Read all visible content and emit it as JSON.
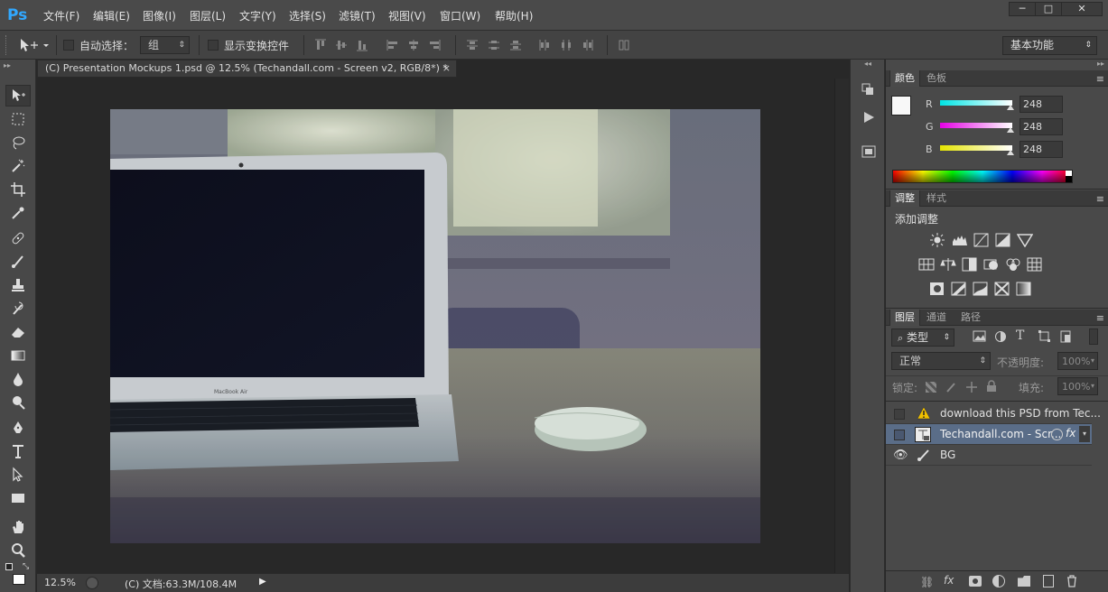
{
  "app": {
    "logo": "Ps"
  },
  "menu": [
    "文件(F)",
    "编辑(E)",
    "图像(I)",
    "图层(L)",
    "文字(Y)",
    "选择(S)",
    "滤镜(T)",
    "视图(V)",
    "窗口(W)",
    "帮助(H)"
  ],
  "window_controls": {
    "minimize": "─",
    "maximize": "□",
    "close": "✕"
  },
  "options": {
    "auto_select_label": "自动选择：",
    "auto_select_value": "组",
    "show_transform_label": "显示变换控件",
    "workspace": "基本功能"
  },
  "document": {
    "tab_title": "(C) Presentation Mockups 1.psd @ 12.5% (Techandall.com - Screen v2, RGB/8*) *",
    "tab_close": "×",
    "photo_caption": "MacBook Air"
  },
  "status": {
    "zoom": "12.5%",
    "doc_info": "(C) 文档:63.3M/108.4M"
  },
  "color_panel": {
    "tabs": [
      "颜色",
      "色板"
    ],
    "channels": [
      {
        "name": "R",
        "value": "248",
        "color": "#00e5e5"
      },
      {
        "name": "G",
        "value": "248",
        "color": "#e500e5"
      },
      {
        "name": "B",
        "value": "248",
        "color": "#e5e500"
      }
    ],
    "foreground": "#f8f8f8",
    "background": "#ffffff"
  },
  "adjust_panel": {
    "tabs": [
      "调整",
      "样式"
    ],
    "title": "添加调整"
  },
  "layers_panel": {
    "tabs": [
      "图层",
      "通道",
      "路径"
    ],
    "filter_label": "类型",
    "blend_mode": "正常",
    "opacity_label": "不透明度:",
    "opacity_value": "100%",
    "lock_label": "锁定:",
    "fill_label": "填充:",
    "fill_value": "100%",
    "layers": [
      {
        "name": "download this PSD from Tec...",
        "visible": false,
        "icon": "warning-icon"
      },
      {
        "name": "Techandall.com - Scr...",
        "visible": false,
        "icon": "smart-object-icon",
        "fx": "fx"
      },
      {
        "name": "BG",
        "visible": true,
        "icon": "brush-icon"
      }
    ],
    "footer_fx": "fx"
  },
  "colors": {
    "accent": "#31a8ff",
    "chrome": "#494949",
    "dark": "#282828"
  }
}
